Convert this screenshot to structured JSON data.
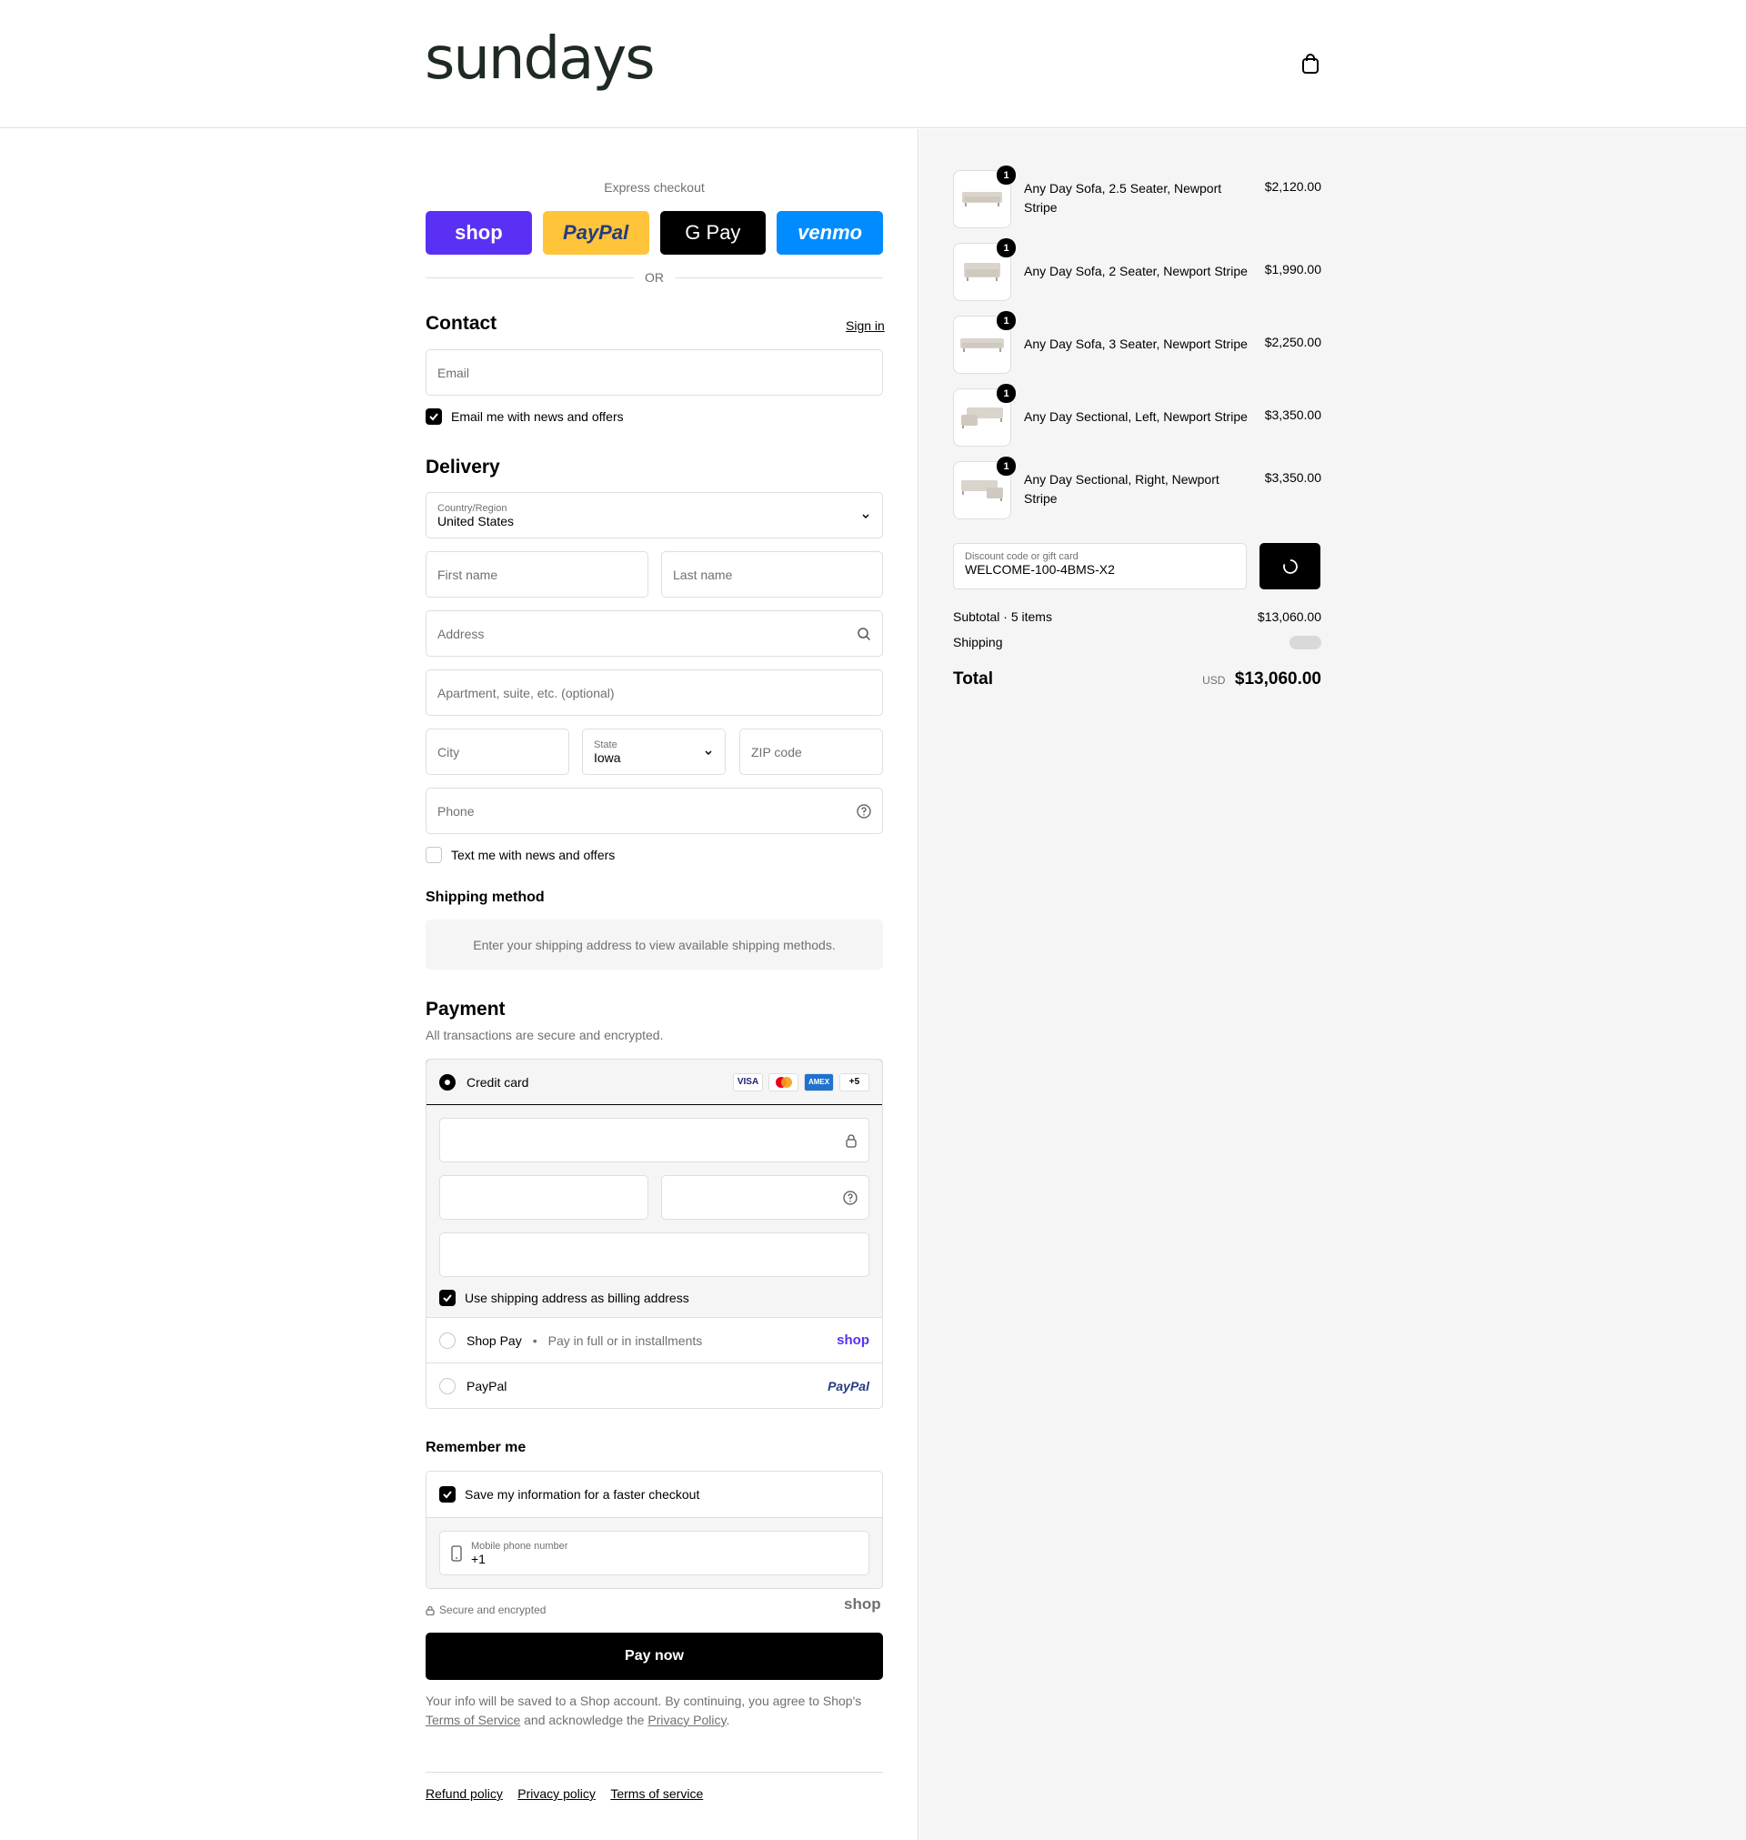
{
  "brand": {
    "logo": "sundays"
  },
  "express": {
    "title": "Express checkout",
    "buttons": [
      {
        "label": "shop",
        "color": "#5a31f4"
      },
      {
        "label": "PayPal",
        "color": "#ffc439"
      },
      {
        "label": "G Pay",
        "color": "#000000"
      },
      {
        "label": "venmo",
        "color": "#008cff"
      }
    ],
    "or": "OR"
  },
  "contact": {
    "heading": "Contact",
    "sign_in": "Sign in",
    "email_placeholder": "Email",
    "news_label": "Email me with news and offers"
  },
  "delivery": {
    "heading": "Delivery",
    "country_label": "Country/Region",
    "country_value": "United States",
    "first_name": "First name",
    "last_name": "Last name",
    "address": "Address",
    "apartment": "Apartment, suite, etc. (optional)",
    "city": "City",
    "state_label": "State",
    "state_value": "Iowa",
    "zip": "ZIP code",
    "phone": "Phone",
    "text_label": "Text me with news and offers"
  },
  "shipping": {
    "heading": "Shipping method",
    "note": "Enter your shipping address to view available shipping methods."
  },
  "payment": {
    "heading": "Payment",
    "subtitle": "All transactions are secure and encrypted.",
    "credit_card": "Credit card",
    "card_badges": [
      "VISA",
      "",
      "AMEX",
      "+5"
    ],
    "billing_label": "Use shipping address as billing address",
    "shop_pay": "Shop Pay",
    "shop_pay_note": "Pay in full or in installments",
    "shop_logo": "shop",
    "paypal": "PayPal",
    "paypal_logo": "PayPal"
  },
  "remember": {
    "heading": "Remember me",
    "save_label": "Save my information for a faster checkout",
    "phone_label": "Mobile phone number",
    "phone_value": "+1",
    "secure": "Secure and encrypted",
    "shop_logo": "shop"
  },
  "pay_now": "Pay now",
  "disclaimer": {
    "text1": "Your info will be saved to a Shop account. By continuing, you agree to Shop's",
    "tos": "Terms of Service",
    "text2": "and acknowledge the",
    "privacy": "Privacy Policy",
    "end": "."
  },
  "footer": {
    "links": [
      "Refund policy",
      "Privacy policy",
      "Terms of service"
    ]
  },
  "summary": {
    "items": [
      {
        "name": "Any Day Sofa, 2.5 Seater, Newport Stripe",
        "price": "$2,120.00",
        "qty": "1"
      },
      {
        "name": "Any Day Sofa, 2 Seater, Newport Stripe",
        "price": "$1,990.00",
        "qty": "1"
      },
      {
        "name": "Any Day Sofa, 3 Seater, Newport Stripe",
        "price": "$2,250.00",
        "qty": "1"
      },
      {
        "name": "Any Day Sectional, Left, Newport Stripe",
        "price": "$3,350.00",
        "qty": "1"
      },
      {
        "name": "Any Day Sectional, Right, Newport Stripe",
        "price": "$3,350.00",
        "qty": "1"
      }
    ],
    "discount_label": "Discount code or gift card",
    "discount_value": "WELCOME-100-4BMS-X2",
    "subtotal_label": "Subtotal · 5 items",
    "subtotal_value": "$13,060.00",
    "shipping_label": "Shipping",
    "total_label": "Total",
    "currency": "USD",
    "total_value": "$13,060.00"
  }
}
